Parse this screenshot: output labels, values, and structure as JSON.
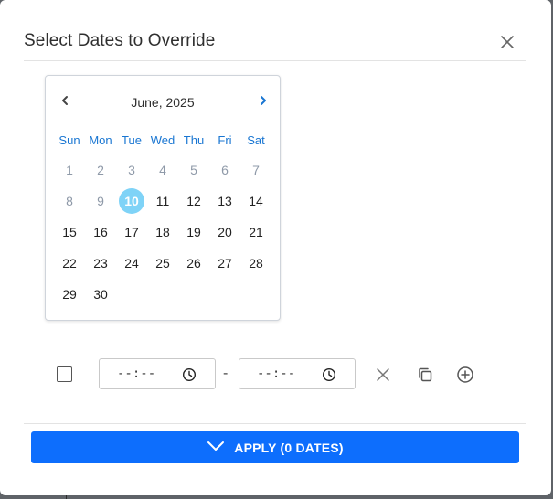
{
  "dialog": {
    "title": "Select Dates to Override",
    "close_icon": "close-icon"
  },
  "calendar": {
    "month_label": "June, 2025",
    "prev_icon": "chevron-left-icon",
    "next_icon": "chevron-right-icon",
    "weekdays": [
      "Sun",
      "Mon",
      "Tue",
      "Wed",
      "Thu",
      "Fri",
      "Sat"
    ],
    "weeks": [
      [
        {
          "d": "1",
          "muted": true
        },
        {
          "d": "2",
          "muted": true
        },
        {
          "d": "3",
          "muted": true
        },
        {
          "d": "4",
          "muted": true
        },
        {
          "d": "5",
          "muted": true
        },
        {
          "d": "6",
          "muted": true
        },
        {
          "d": "7",
          "muted": true
        }
      ],
      [
        {
          "d": "8",
          "muted": true
        },
        {
          "d": "9",
          "muted": true
        },
        {
          "d": "10",
          "selected": true
        },
        {
          "d": "11"
        },
        {
          "d": "12"
        },
        {
          "d": "13"
        },
        {
          "d": "14"
        }
      ],
      [
        {
          "d": "15"
        },
        {
          "d": "16"
        },
        {
          "d": "17"
        },
        {
          "d": "18"
        },
        {
          "d": "19"
        },
        {
          "d": "20"
        },
        {
          "d": "21"
        }
      ],
      [
        {
          "d": "22"
        },
        {
          "d": "23"
        },
        {
          "d": "24"
        },
        {
          "d": "25"
        },
        {
          "d": "26"
        },
        {
          "d": "27"
        },
        {
          "d": "28"
        }
      ],
      [
        {
          "d": "29"
        },
        {
          "d": "30"
        }
      ]
    ],
    "selected_color": "#7fd3f7",
    "weekday_color": "#1976d2"
  },
  "time_row": {
    "checked": false,
    "start_time": "--:--",
    "separator": "-",
    "end_time": "--:--",
    "clock_icon": "clock-icon",
    "remove_icon": "close-icon",
    "copy_icon": "copy-icon",
    "add_icon": "plus-circle-icon"
  },
  "footer": {
    "apply_label": "APPLY (0 DATES)",
    "apply_icon": "chevron-down-icon",
    "apply_color": "#0d6efd"
  }
}
